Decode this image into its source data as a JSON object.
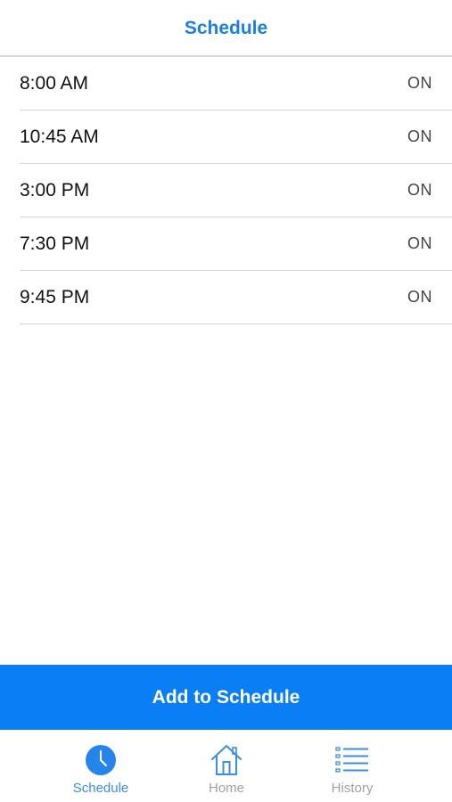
{
  "header": {
    "title": "Schedule"
  },
  "schedule": {
    "items": [
      {
        "time": "8:00 AM",
        "status": "ON"
      },
      {
        "time": "10:45 AM",
        "status": "ON"
      },
      {
        "time": "3:00 PM",
        "status": "ON"
      },
      {
        "time": "7:30 PM",
        "status": "ON"
      },
      {
        "time": "9:45 PM",
        "status": "ON"
      }
    ]
  },
  "actions": {
    "add_label": "Add to Schedule"
  },
  "tabbar": {
    "tabs": [
      {
        "label": "Schedule",
        "icon": "clock-icon",
        "active": true
      },
      {
        "label": "Home",
        "icon": "home-icon",
        "active": false
      },
      {
        "label": "History",
        "icon": "list-icon",
        "active": false
      }
    ]
  },
  "colors": {
    "accent": "#0a7ff5",
    "title": "#1a7fe0",
    "inactive_tab": "#a0a0a0"
  }
}
